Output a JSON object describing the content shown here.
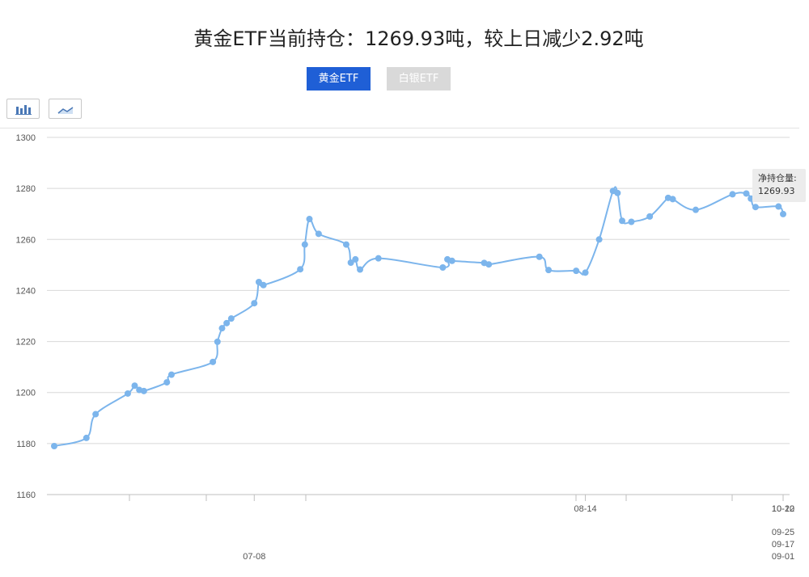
{
  "header": {
    "title": "黄金ETF当前持仓：1269.93吨，较上日减少2.92吨"
  },
  "tabs": [
    {
      "label": "黄金ETF",
      "active": true
    },
    {
      "label": "白银ETF",
      "active": false
    }
  ],
  "toolbar": {
    "bar_icon": "bar-chart-icon",
    "line_icon": "line-chart-icon"
  },
  "tooltip": {
    "label": "净持仓量:",
    "value": "1269.93"
  },
  "colors": {
    "line": "#7cb5ec",
    "active_tab": "#1f5fd6",
    "inactive_tab": "#d9d9d9"
  },
  "chart_data": {
    "type": "line",
    "ylim": [
      1160,
      1300
    ],
    "yticks": [
      1160,
      1180,
      1200,
      1220,
      1240,
      1260,
      1280,
      1300
    ],
    "grid": true,
    "legend": "none",
    "xtick_labels": [
      {
        "label": "07-08",
        "index": 14,
        "row": 3
      },
      {
        "label": "08-14",
        "index": 34,
        "row": 1
      },
      {
        "label": "09-01",
        "index": 49,
        "row": 3
      },
      {
        "label": "09-17",
        "index": 55,
        "row": 2
      },
      {
        "label": "09-25",
        "index": 58,
        "row": 1.5
      },
      {
        "label": "10-12",
        "index": 67,
        "row": 1
      },
      {
        "label": "10-20",
        "index": 71,
        "row": 0
      }
    ],
    "values": [
      1179.0,
      1182.2,
      1191.5,
      1199.6,
      1202.7,
      1201.0,
      1200.6,
      1204.0,
      1207.0,
      1212.0,
      1219.9,
      1225.2,
      1227.2,
      1229.0,
      1235.0,
      1243.3,
      1242.1,
      1248.3,
      1258.0,
      1268.0,
      1262.2,
      1258.0,
      1250.9,
      1252.2,
      1248.2,
      1252.6,
      1249.0,
      1252.2,
      1251.6,
      1250.8,
      1250.2,
      1253.2,
      1248.0,
      1247.7,
      1247.0,
      1260.0,
      1279.0,
      1278.2,
      1267.3,
      1266.9,
      1269.0,
      1276.3,
      1275.8,
      1271.6,
      1277.7,
      1278.0,
      1276.0,
      1272.7,
      1272.9,
      1269.93
    ],
    "x_positions": [
      0,
      7,
      9,
      16,
      17.5,
      18.5,
      19.5,
      24.5,
      25.5,
      34.5,
      35.5,
      36.5,
      37.5,
      38.5,
      43.5,
      44.5,
      45.5,
      53.5,
      54.5,
      55.5,
      57.5,
      63.5,
      64.5,
      65.5,
      66.5,
      70.5,
      84.5,
      85.5,
      86.5,
      93.5,
      94.5,
      105.5,
      107.5,
      113.5,
      115.5,
      118.5,
      121.5,
      122.5,
      123.5,
      125.5,
      129.5,
      133.5,
      134.5,
      139.5,
      147.5,
      150.5,
      151.5,
      152.5,
      157.5,
      158.5
    ]
  }
}
